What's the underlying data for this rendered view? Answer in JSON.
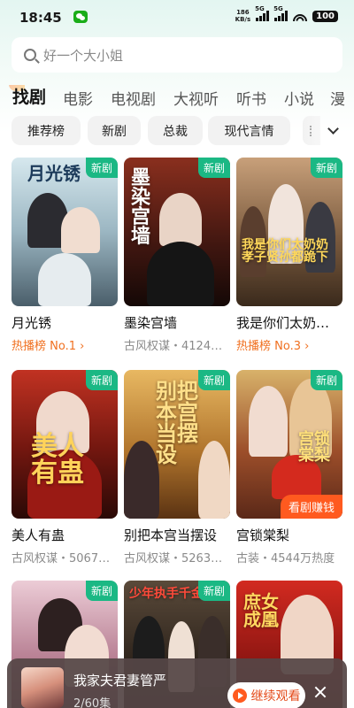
{
  "status_bar": {
    "time": "18:45",
    "net_speed_value": "186",
    "net_speed_unit": "KB/s",
    "signal1": "5G",
    "signal2": "5G",
    "battery": "100"
  },
  "search": {
    "placeholder": "好一个大小姐"
  },
  "main_tabs": [
    {
      "label": "找剧",
      "active": true
    },
    {
      "label": "电影"
    },
    {
      "label": "电视剧"
    },
    {
      "label": "大视听"
    },
    {
      "label": "听书"
    },
    {
      "label": "小说"
    },
    {
      "label": "漫"
    }
  ],
  "filter_chips": [
    "推荐榜",
    "新剧",
    "总裁",
    "现代言情"
  ],
  "cards": [
    {
      "title": "月光锈",
      "sub": "热播榜 No.1",
      "hot": true,
      "badge": "新剧",
      "art": "月光锈",
      "colors": [
        "#cfe3ea",
        "#8fa9b6",
        "#3b4d5a"
      ]
    },
    {
      "title": "墨染宫墙",
      "sub": "古风权谋・4124…",
      "badge": "新剧",
      "art": "墨染宫墙",
      "colors": [
        "#7a2a1c",
        "#3b1410",
        "#1a0b08"
      ]
    },
    {
      "title": "我是你们太奶…",
      "sub": "热播榜 No.3",
      "hot": true,
      "badge": "新剧",
      "art": "我是你们太奶奶 孝子贤孙都跪下",
      "colors": [
        "#c9a47c",
        "#7a5a3e",
        "#3e2b1e"
      ]
    },
    {
      "title": "美人有蛊",
      "sub": "古风权谋・5067…",
      "badge": "新剧",
      "art": "美人有蛊",
      "colors": [
        "#b3281c",
        "#6e1410",
        "#2d0a08"
      ]
    },
    {
      "title": "别把本宫当摆设",
      "sub": "古风权谋・5263…",
      "badge": "新剧",
      "art": "别把本宫当摆设",
      "colors": [
        "#e6b25a",
        "#a86a24",
        "#5a3212"
      ]
    },
    {
      "title": "宫锁棠梨",
      "sub": "古装・4544万热度",
      "badge": "新剧",
      "art": "宫锁棠梨",
      "earn": "看剧赚钱",
      "colors": [
        "#d9b46a",
        "#a0522d",
        "#5c2a18"
      ]
    },
    {
      "title": "",
      "sub": "",
      "badge": "新剧",
      "art": "",
      "colors": [
        "#e8c7d0",
        "#b77d92",
        "#6e4a5a"
      ]
    },
    {
      "title": "",
      "sub": "",
      "badge": "新剧",
      "art": "少年执手千金",
      "colors": [
        "#5a4a3a",
        "#2e241c",
        "#15110d"
      ]
    },
    {
      "title": "",
      "sub": "",
      "badge": "",
      "art": "庶女成凰",
      "colors": [
        "#c8201a",
        "#8a1410",
        "#3d0a08"
      ]
    }
  ],
  "mini_player": {
    "title": "我家夫君妻管严",
    "episode": "2/60集",
    "continue_label": "继续观看"
  },
  "colors": {
    "accent_green": "#1bb884",
    "accent_orange": "#ff5a1f",
    "hot_text": "#f07020"
  }
}
